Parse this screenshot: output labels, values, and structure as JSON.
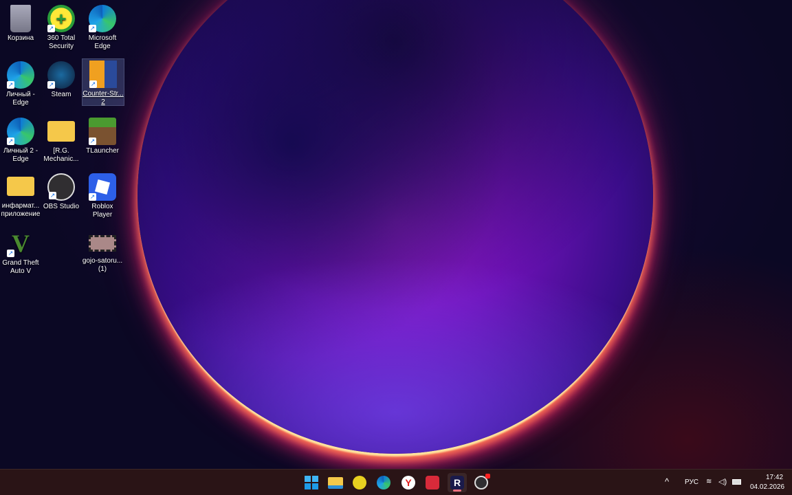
{
  "desktop": {
    "icons": [
      {
        "label": "Корзина",
        "icon": "recycle-bin-icon"
      },
      {
        "label": "360 Total Security",
        "icon": "360-security-icon"
      },
      {
        "label": "Microsoft Edge",
        "icon": "edge-icon"
      },
      {
        "label": "Личный - Edge",
        "icon": "edge-profile-icon"
      },
      {
        "label": "Steam",
        "icon": "steam-icon"
      },
      {
        "label": "Counter-Str... 2",
        "icon": "counter-strike-icon"
      },
      {
        "label": "Личный 2 - Edge",
        "icon": "edge-profile-icon"
      },
      {
        "label": "[R.G. Mechanic...",
        "icon": "folder-icon"
      },
      {
        "label": "TLauncher",
        "icon": "tlauncher-icon"
      },
      {
        "label": "инфармат... приложение",
        "icon": "folder-icon"
      },
      {
        "label": "OBS Studio",
        "icon": "obs-icon"
      },
      {
        "label": "Roblox Player",
        "icon": "roblox-icon"
      },
      {
        "label": "Grand Theft Auto V",
        "icon": "gta-icon"
      },
      {
        "label": "gojo-satoru... (1)",
        "icon": "video-file-icon"
      }
    ]
  },
  "taskbar": {
    "apps": [
      "start",
      "file-explorer",
      "app-yellow",
      "edge",
      "yandex-browser",
      "app-red",
      "rockstar-launcher",
      "obs"
    ],
    "tray": {
      "language": "РУС",
      "time": "17:42",
      "date": "04.02.2026"
    }
  }
}
